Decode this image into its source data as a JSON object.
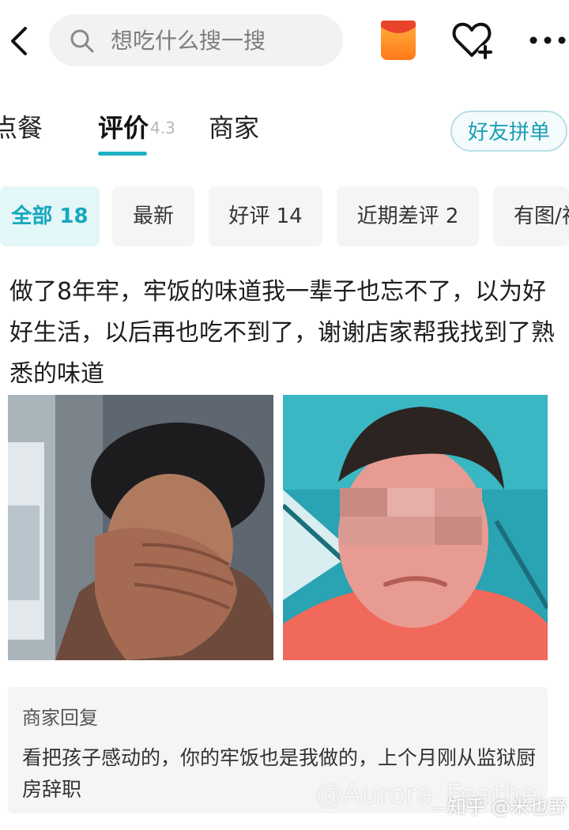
{
  "search": {
    "placeholder": "想吃什么搜一搜"
  },
  "tabs": [
    {
      "label": "点餐"
    },
    {
      "label": "评价",
      "rating": "4.3"
    },
    {
      "label": "商家"
    }
  ],
  "group_order_label": "好友拼单",
  "filters": [
    {
      "label": "全部 18"
    },
    {
      "label": "最新"
    },
    {
      "label": "好评 14"
    },
    {
      "label": "近期差评 2"
    },
    {
      "label": "有图/视"
    }
  ],
  "review": {
    "text": "做了8年牢，牢饭的味道我一辈子也忘不了，以为好好生活，以后再也吃不到了，谢谢店家帮我找到了熟悉的味道"
  },
  "merchant_reply": {
    "title": "商家回复",
    "text": "看把孩子感动的，你的牢饭也是我做的，上个月刚从监狱厨房辞职"
  },
  "watermarks": {
    "aurora": "@Aurora_Feathe",
    "zhihu": "知乎 @米也野"
  },
  "colors": {
    "accent": "#1fb0c4",
    "accent_text": "#16a7bd",
    "chip_bg": "#f5f5f5",
    "reply_bg": "#f5f5f5"
  }
}
